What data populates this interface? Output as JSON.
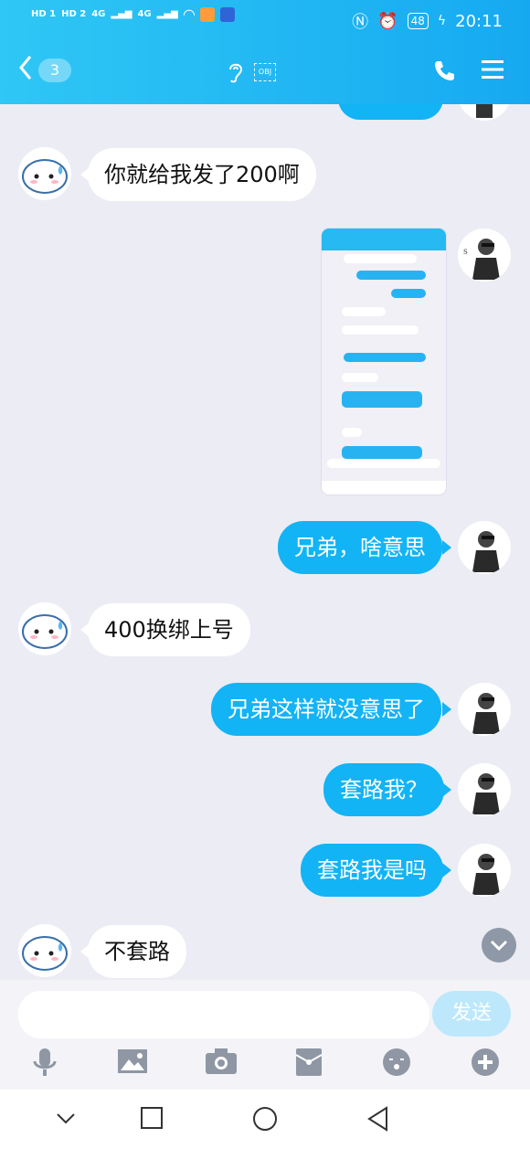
{
  "status_bar": {
    "left_labels": [
      "HD 1",
      "HD 2",
      "4G",
      "4G"
    ],
    "battery": "48",
    "time": "20:11"
  },
  "header": {
    "back_count": "3",
    "obj_label": "OBJ"
  },
  "messages": [
    {
      "side": "in",
      "text": "你就给我发了200啊"
    },
    {
      "side": "out",
      "text": "兄弟，啥意思"
    },
    {
      "side": "in",
      "text": "400换绑上号"
    },
    {
      "side": "out",
      "text": "兄弟这样就没意思了"
    },
    {
      "side": "out",
      "text": "套路我？"
    },
    {
      "side": "out",
      "text": "套路我是吗"
    },
    {
      "side": "in",
      "text": "不套路"
    }
  ],
  "input": {
    "value": "",
    "placeholder": "",
    "send_label": "发送"
  },
  "toolbar_icons": [
    "microphone-icon",
    "image-icon",
    "camera-icon",
    "red-packet-icon",
    "emoji-icon",
    "plus-icon"
  ],
  "nav_icons": [
    "chevron-down-icon",
    "recent-apps-icon",
    "home-icon",
    "back-icon"
  ],
  "colors": {
    "header_start": "#2fc7f5",
    "header_end": "#16a9f1",
    "outgoing_bubble": "#12b4f5",
    "chat_background": "#ececf4"
  }
}
